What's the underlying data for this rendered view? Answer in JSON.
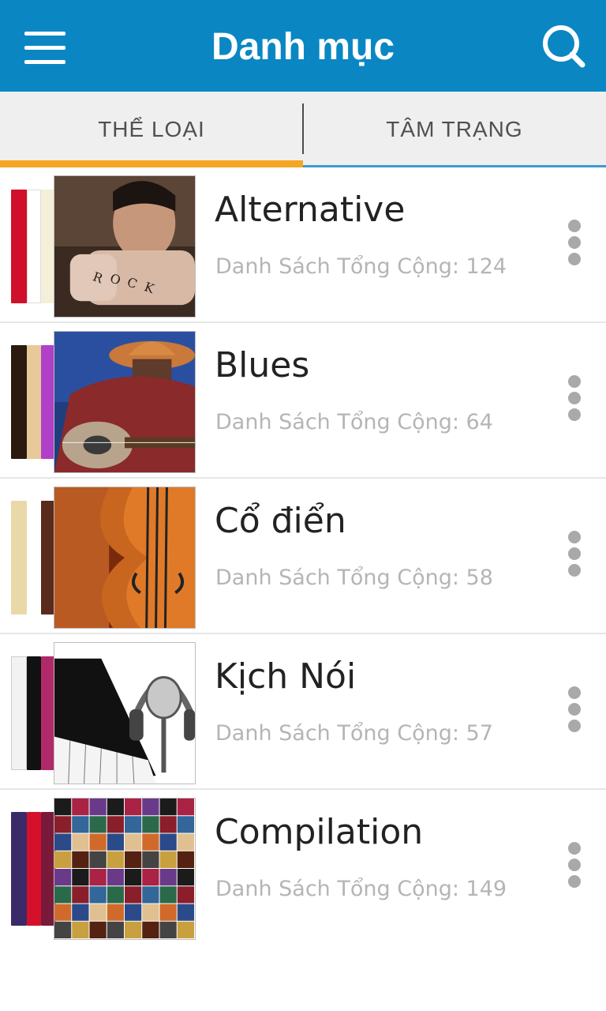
{
  "header": {
    "title": "Danh mục",
    "menu_icon": "hamburger-menu-icon",
    "search_icon": "search-icon",
    "background": "#0a87c3"
  },
  "tabs": [
    {
      "label": "THỂ LOẠI",
      "selected": true
    },
    {
      "label": "TÂM TRẠNG",
      "selected": false
    }
  ],
  "accent_color": "#f5a623",
  "categories": [
    {
      "name": "Alternative",
      "count_label": "Danh Sách Tổng Cộng: 124",
      "cover": "rocker-fist-art",
      "more_icon": "more-vertical-icon"
    },
    {
      "name": "Blues",
      "count_label": "Danh Sách Tổng Cộng: 64",
      "cover": "blues-guitarist-art",
      "more_icon": "more-vertical-icon"
    },
    {
      "name": "Cổ điển",
      "count_label": "Danh Sách Tổng Cộng: 58",
      "cover": "violin-art",
      "more_icon": "more-vertical-icon"
    },
    {
      "name": "Kịch Nói",
      "count_label": "Danh Sách Tổng Cộng: 57",
      "cover": "microphone-piano-art",
      "more_icon": "more-vertical-icon"
    },
    {
      "name": "Compilation",
      "count_label": "Danh Sách Tổng Cộng: 149",
      "cover": "album-mosaic-art",
      "more_icon": "more-vertical-icon"
    }
  ]
}
